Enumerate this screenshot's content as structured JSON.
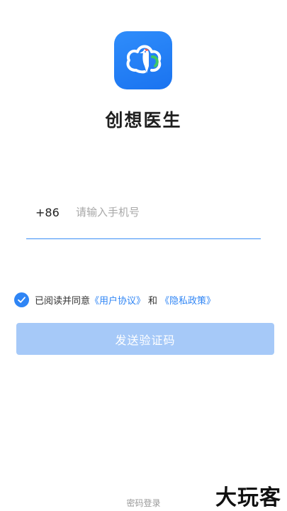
{
  "app": {
    "name": "创想医生",
    "logo_icon": "cloud-woodpecker-icon",
    "brand_color": "#1a73f0"
  },
  "login": {
    "country_code": "+86",
    "phone_placeholder": "请输入手机号",
    "phone_value": "",
    "agreement": {
      "checked": true,
      "prefix": "已阅读并同意",
      "user_agreement": "《用户协议》",
      "conjunction": "和",
      "privacy_policy": "《隐私政策》"
    },
    "send_code_label": "发送验证码",
    "password_login_label": "密码登录"
  },
  "watermark": "大玩客",
  "colors": {
    "accent": "#2f85f5",
    "button_disabled": "#a6c9f8",
    "placeholder": "#a8a8a8"
  }
}
